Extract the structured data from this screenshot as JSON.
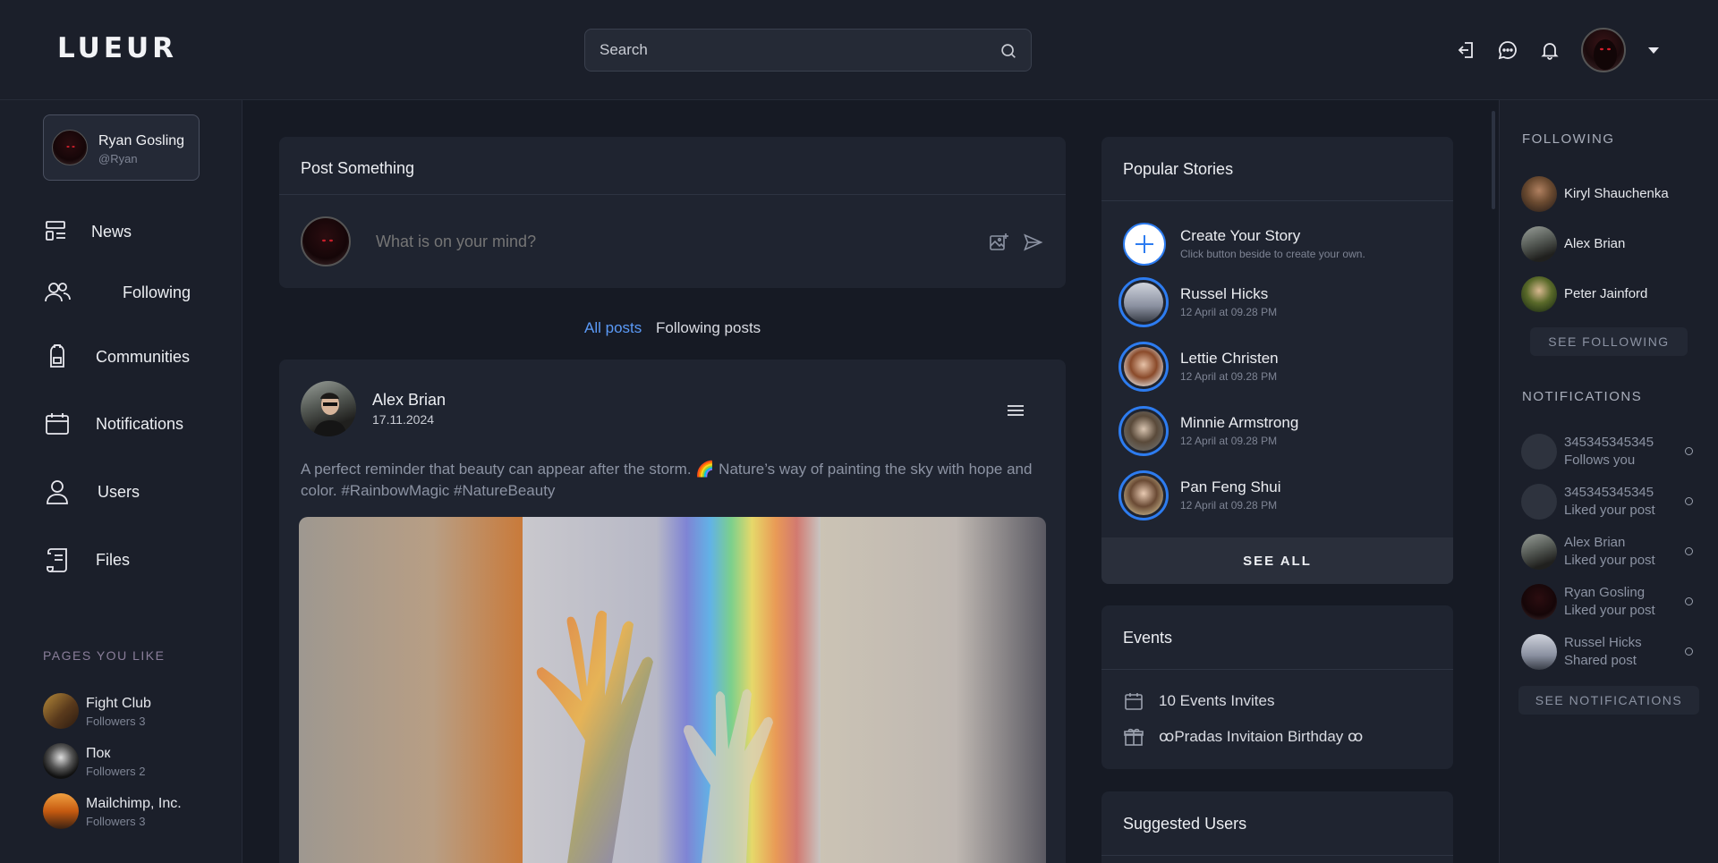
{
  "header": {
    "logo": "LUEUR",
    "search_placeholder": "Search"
  },
  "profile": {
    "name": "Ryan Gosling",
    "handle": "@Ryan"
  },
  "nav": [
    {
      "label": "News",
      "icon": "newspaper-icon"
    },
    {
      "label": "Following",
      "icon": "users-icon"
    },
    {
      "label": "Communities",
      "icon": "backpack-icon"
    },
    {
      "label": "Notifications",
      "icon": "calendar-icon"
    },
    {
      "label": "Users",
      "icon": "user-icon"
    },
    {
      "label": "Files",
      "icon": "scroll-icon"
    }
  ],
  "pages_you_like": {
    "label": "PAGES YOU LIKE",
    "items": [
      {
        "name": "Fight Club",
        "followers": "Followers 3"
      },
      {
        "name": "Пок",
        "followers": "Followers 2"
      },
      {
        "name": "Mailchimp, Inc.",
        "followers": "Followers 3"
      }
    ]
  },
  "composer": {
    "title": "Post Something",
    "placeholder": "What is on your mind?"
  },
  "tabs": {
    "all": "All posts",
    "following": "Following posts"
  },
  "post": {
    "author": "Alex Brian",
    "date": "17.11.2024",
    "text": "A perfect reminder that beauty can appear after the storm. 🌈 Nature’s way of painting the sky with hope and color. #RainbowMagic #NatureBeauty"
  },
  "stories": {
    "title": "Popular Stories",
    "create_title": "Create Your Story",
    "create_sub": "Click button beside to create your own.",
    "items": [
      {
        "name": "Russel Hicks",
        "time": "12 April at 09.28 PM"
      },
      {
        "name": "Lettie Christen",
        "time": "12 April at 09.28 PM"
      },
      {
        "name": "Minnie Armstrong",
        "time": "12 April at 09.28 PM"
      },
      {
        "name": "Pan Feng Shui",
        "time": "12 April at 09.28 PM"
      }
    ],
    "see_all": "SEE ALL"
  },
  "events": {
    "title": "Events",
    "invites": "10 Events Invites",
    "birthday": "ꝏPradas Invitaion Birthday ꝏ"
  },
  "suggested": {
    "title": "Suggested Users"
  },
  "following": {
    "label": "FOLLOWING",
    "items": [
      "Kiryl Shauchenka",
      "Alex Brian",
      "Peter Jainford"
    ],
    "button": "SEE FOLLOWING"
  },
  "notifications": {
    "label": "NOTIFICATIONS",
    "items": [
      {
        "name": "345345345345",
        "action": "Follows you"
      },
      {
        "name": "345345345345",
        "action": "Liked your post"
      },
      {
        "name": "Alex Brian",
        "action": "Liked your post"
      },
      {
        "name": "Ryan Gosling",
        "action": "Liked your post"
      },
      {
        "name": "Russel Hicks",
        "action": "Shared post"
      }
    ],
    "button": "SEE NOTIFICATIONS"
  },
  "colors": {
    "accent": "#5b9af7",
    "story_ring": "#2d7cf0",
    "background": "#161a24",
    "panel": "#1b1f2a",
    "card": "#1f2430"
  }
}
